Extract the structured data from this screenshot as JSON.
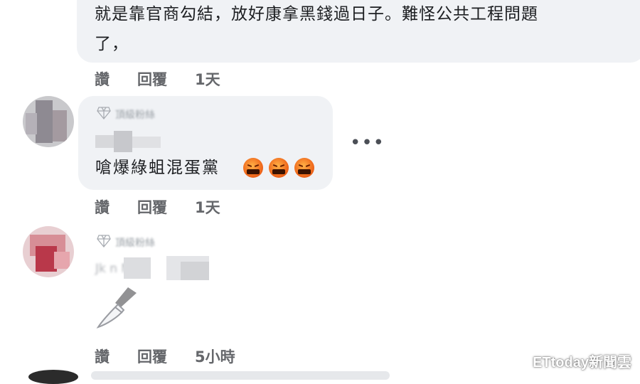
{
  "comment1": {
    "line1": "就是靠官商勾結，放好康拿黑錢過日子。難怪公共工程問題",
    "line2": "了，"
  },
  "actions1": {
    "like": "讚",
    "reply": "回覆",
    "time": "1天"
  },
  "comment2": {
    "badge": "頂級粉絲",
    "name": "",
    "text": "嗆爆綠蛆混蛋黨",
    "emojis": [
      "angry-face",
      "angry-face",
      "angry-face"
    ],
    "more": "•••"
  },
  "actions2": {
    "like": "讚",
    "reply": "回覆",
    "time": "1天"
  },
  "comment3": {
    "badge": "頂級粉絲",
    "name": "Jk  n M",
    "sticker": "knife-icon"
  },
  "actions3": {
    "like": "讚",
    "reply": "回覆",
    "time": "5小時"
  },
  "watermark": "ETtoday新聞雲",
  "colors": {
    "bubble": "#f0f2f5",
    "action_text": "#65676b",
    "text": "#1c1e21"
  }
}
